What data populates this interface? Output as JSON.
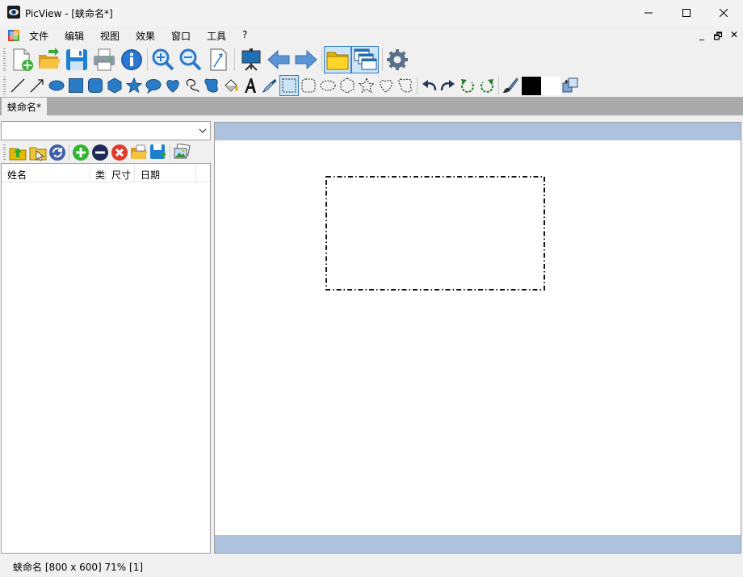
{
  "window": {
    "title": "PicView - [蛱命名*]",
    "icon": "eye-app-icon",
    "controls": [
      "minimize-icon",
      "maximize-icon",
      "close-icon"
    ]
  },
  "menu": {
    "items": [
      "文件",
      "编辑",
      "视图",
      "效果",
      "窗口",
      "工具",
      "?"
    ],
    "mdi_controls": [
      "_",
      "🗗",
      "✕"
    ]
  },
  "toolbar1": {
    "buttons": [
      "new-file-icon",
      "open-folder-icon",
      "save-disk-icon",
      "print-icon",
      "info-icon",
      "zoom-in-icon",
      "zoom-out-icon",
      "fit-page-icon",
      "slideshow-icon",
      "prev-arrow-icon",
      "next-arrow-icon",
      "folder-view-icon",
      "window-view-icon",
      "settings-gear-icon"
    ]
  },
  "toolbar2": {
    "buttons": [
      "line-icon",
      "arrow-line-icon",
      "ellipse-icon",
      "rectangle-icon",
      "rounded-rect-icon",
      "hexagon-icon",
      "star-icon",
      "speech-bubble-icon",
      "heart-icon",
      "lasso-icon",
      "blob-shape-icon",
      "fill-bucket-icon",
      "text-tool-icon",
      "eyedropper-icon",
      "rect-select-icon",
      "rounded-select-icon",
      "ellipse-select-icon",
      "hexagon-select-icon",
      "star-select-icon",
      "heart-select-icon",
      "freeform-select-icon",
      "undo-icon",
      "redo-icon",
      "rotate-left-icon",
      "rotate-right-icon",
      "brush-icon",
      "foreground-color-swatch",
      "background-color-swatch",
      "swap-colors-icon"
    ],
    "foreground_color": "#000000",
    "background_color": "#ffffff"
  },
  "tabs": [
    {
      "label": "蛱命名*",
      "active": true
    }
  ],
  "left_panel": {
    "combo_value": "",
    "toolbar": [
      "up-folder-icon",
      "select-folder-icon",
      "refresh-icon",
      "add-icon",
      "remove-icon",
      "delete-icon",
      "open-folder-small-icon",
      "save-small-icon",
      "image-gallery-icon"
    ],
    "columns": [
      "姓名",
      "类",
      "尺寸",
      "日期"
    ]
  },
  "viewer": {
    "band_color": "#adc2de",
    "selection_shape": "dash-dot rectangle"
  },
  "status": {
    "text": "蛱命名 [800 x 600] 71% [1]"
  }
}
